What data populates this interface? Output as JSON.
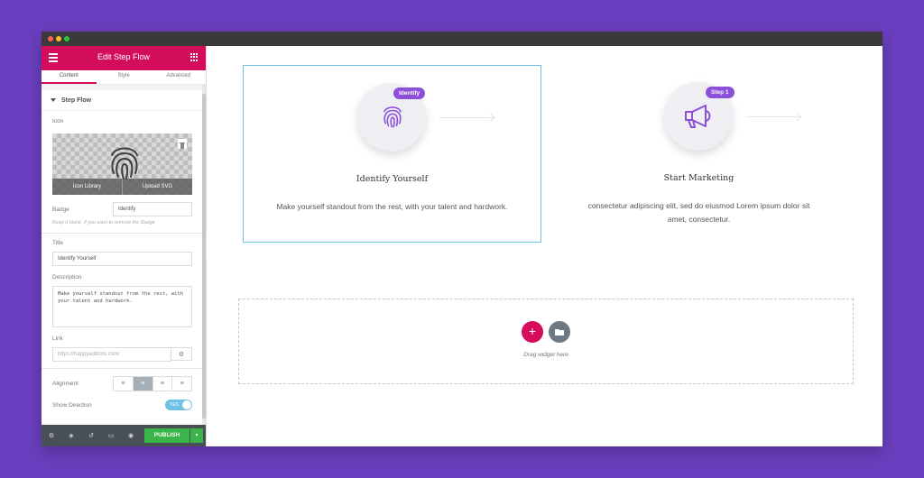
{
  "panel": {
    "title": "Edit Step Flow",
    "tabs": [
      "Content",
      "Style",
      "Advanced"
    ],
    "section_title": "Step Flow",
    "icon_label": "Icon",
    "icon_library": "Icon Library",
    "upload_svg": "Upload SVG",
    "badge_label": "Badge",
    "badge_value": "Identify",
    "badge_hint": "Keep it blank, if you want to remove the Badge",
    "title_label": "Title",
    "title_value": "Identify Yourself",
    "description_label": "Description",
    "description_value": "Make yourself standout from the rest, with your talent and hardwork.",
    "link_label": "Link",
    "link_placeholder": "https://happyaddons.com/",
    "alignment_label": "Alignment",
    "show_direction_label": "Show Direction",
    "toggle_text": "YES",
    "publish": "PUBLISH"
  },
  "canvas": {
    "steps": [
      {
        "badge": "Identify",
        "title": "Identify Yourself",
        "description": "Make yourself standout from the rest, with your talent and hardwork."
      },
      {
        "badge": "Step 1",
        "title": "Start Marketing",
        "description": "consectetur adipiscing elit, sed do eiusmod Lorem ipsum dolor sit amet, consectetur."
      }
    ],
    "drop_text": "Drag widget here"
  },
  "colors": {
    "brand": "#d30c5c",
    "badge": "#8c4fd9",
    "publish": "#39b54a",
    "background": "#6a3fbf"
  }
}
